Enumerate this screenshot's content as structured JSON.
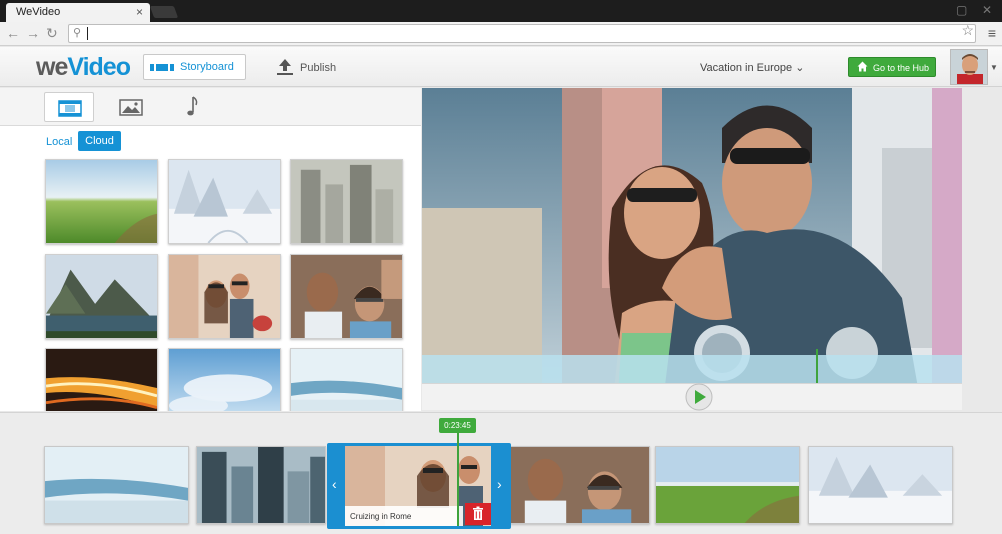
{
  "browser": {
    "tab_title": "WeVideo",
    "tab_close": "×",
    "omnibox_value": "",
    "icons": [
      "back-icon",
      "forward-icon",
      "reload-icon",
      "search-icon",
      "star-icon",
      "menu-icon",
      "minimize-icon",
      "close-window-icon"
    ]
  },
  "header": {
    "logo_we": "we",
    "logo_video": "Video",
    "storyboard_label": "Storyboard",
    "publish_label": "Publish",
    "project_name": "Vacation in Europe",
    "hub_label": "Go to the Hub"
  },
  "media": {
    "tabs": [
      "film-icon",
      "image-icon",
      "music-note-icon"
    ],
    "active_tab": "film-icon",
    "source_local": "Local",
    "source_cloud": "Cloud",
    "active_source": "Cloud"
  },
  "timeline": {
    "time_badge": "0:23:45",
    "selected_clip_title": "Cruizing in Rome"
  },
  "colors": {
    "accent_blue": "#1592d5",
    "hub_green": "#3faa3c",
    "delete_red": "#d8242a"
  }
}
